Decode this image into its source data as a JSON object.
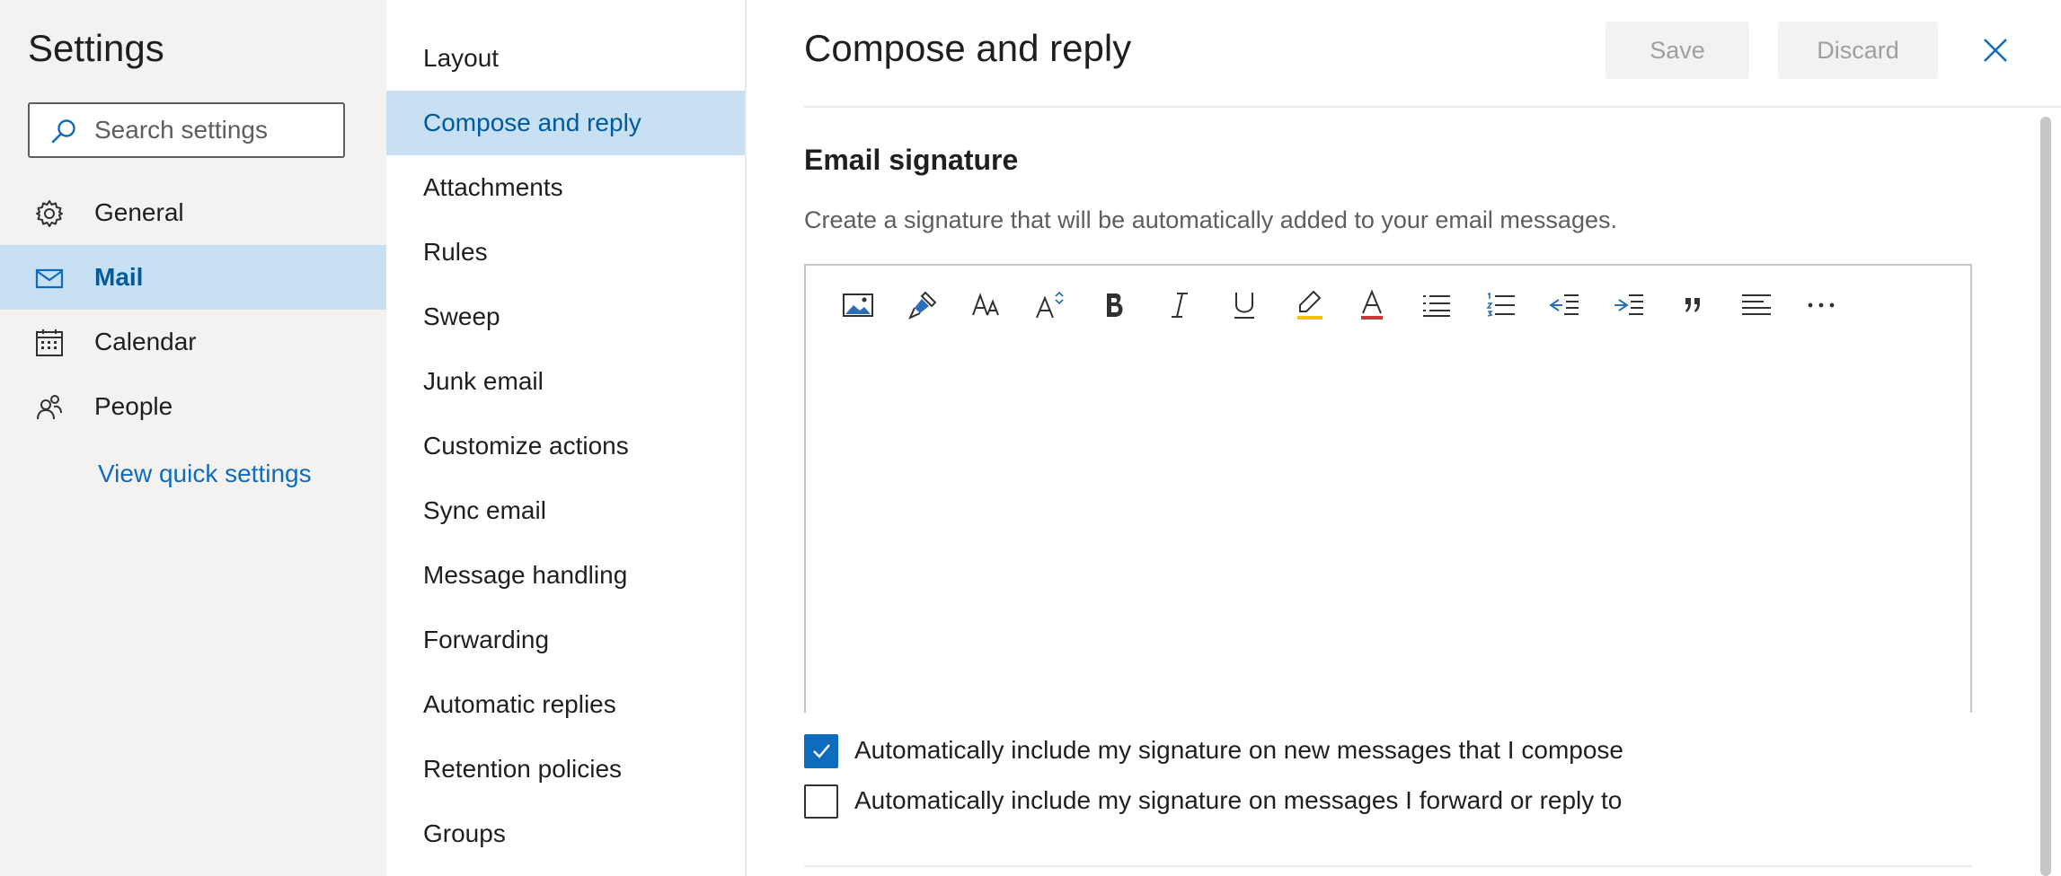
{
  "sidebar": {
    "title": "Settings",
    "search_placeholder": "Search settings",
    "items": [
      {
        "label": "General",
        "icon": "gear-icon"
      },
      {
        "label": "Mail",
        "icon": "mail-icon",
        "selected": true
      },
      {
        "label": "Calendar",
        "icon": "calendar-icon"
      },
      {
        "label": "People",
        "icon": "people-icon"
      }
    ],
    "quick_settings_link": "View quick settings"
  },
  "subnav": {
    "items": [
      "Layout",
      "Compose and reply",
      "Attachments",
      "Rules",
      "Sweep",
      "Junk email",
      "Customize actions",
      "Sync email",
      "Message handling",
      "Forwarding",
      "Automatic replies",
      "Retention policies",
      "Groups"
    ],
    "selected": "Compose and reply"
  },
  "main": {
    "title": "Compose and reply",
    "save_label": "Save",
    "discard_label": "Discard",
    "section_title": "Email signature",
    "section_description": "Create a signature that will be automatically added to your email messages.",
    "toolbar_icons": [
      "insert-picture-icon",
      "format-painter-icon",
      "font-icon",
      "font-size-icon",
      "bold-icon",
      "italic-icon",
      "underline-icon",
      "highlight-icon",
      "font-color-icon",
      "bullets-icon",
      "numbering-icon",
      "decrease-indent-icon",
      "increase-indent-icon",
      "quote-icon",
      "align-icon",
      "more-options-icon"
    ],
    "checkbox_new_messages": {
      "label": "Automatically include my signature on new messages that I compose",
      "checked": true
    },
    "checkbox_forward_reply": {
      "label": "Automatically include my signature on messages I forward or reply to",
      "checked": false
    }
  },
  "colors": {
    "accent": "#0f6cbd",
    "selected_bg": "#c7e0f4",
    "sidebar_bg": "#f3f2f1",
    "highlight_yellow": "#f5c400",
    "font_red": "#d13438"
  }
}
